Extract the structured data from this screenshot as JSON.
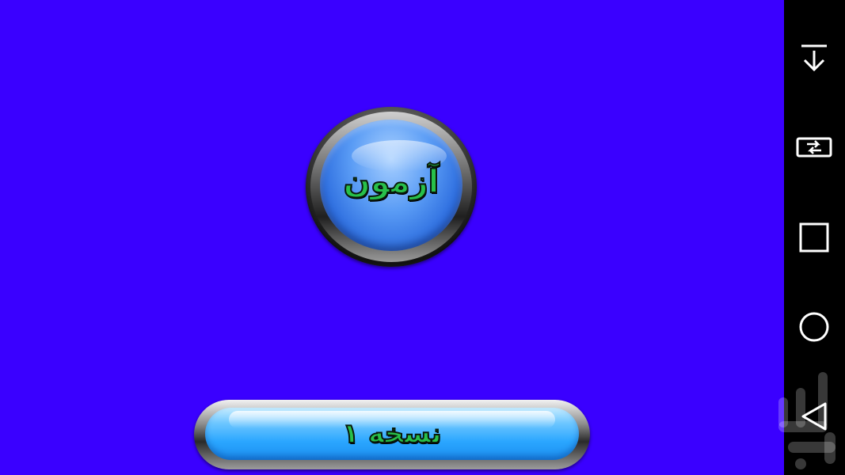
{
  "app": {
    "background_color": "#3a00ff",
    "quiz_button": {
      "label": "آزمون",
      "text_color": "#28c04a",
      "face_color": "#5a9cf5"
    },
    "version_button": {
      "label": "نسخه ۱",
      "text_color": "#28c04a",
      "face_color": "#2aa6ff"
    }
  },
  "nav_bar": {
    "background_color": "#000000",
    "buttons": [
      {
        "icon": "download-arrow-icon"
      },
      {
        "icon": "rotate-screen-icon"
      },
      {
        "icon": "recents-square-icon"
      },
      {
        "icon": "home-circle-icon"
      },
      {
        "icon": "back-triangle-icon"
      }
    ]
  }
}
